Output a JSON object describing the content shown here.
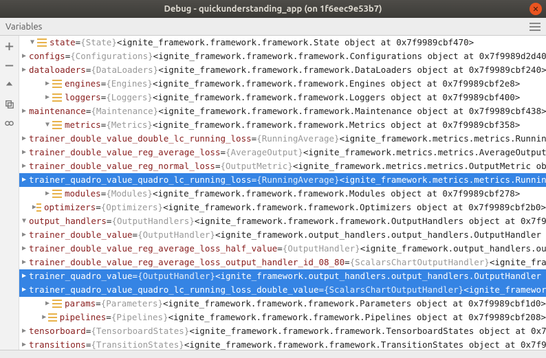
{
  "window": {
    "title": "Debug - quickunderstanding_app (on 1f6eec9e53b7)",
    "tab": "Variables"
  },
  "tree": [
    {
      "depth": 0,
      "arrow": "down",
      "name": "state",
      "eq": " = ",
      "type": "{State}",
      "desc": " <ignite_framework.framework.framework.State object at 0x7f9989cbf470>",
      "sel": false
    },
    {
      "depth": 1,
      "arrow": "right",
      "name": "configs",
      "eq": " = ",
      "type": "{Configurations}",
      "desc": " <ignite_framework.framework.framework.Configurations object at 0x7f9989d2d400>",
      "sel": false
    },
    {
      "depth": 1,
      "arrow": "right",
      "name": "dataloaders",
      "eq": " = ",
      "type": "{DataLoaders}",
      "desc": " <ignite_framework.framework.framework.DataLoaders object at 0x7f9989cbf240>",
      "sel": false
    },
    {
      "depth": 1,
      "arrow": "right",
      "name": "engines",
      "eq": " = ",
      "type": "{Engines}",
      "desc": " <ignite_framework.framework.framework.Engines object at 0x7f9989cbf2e8>",
      "sel": false
    },
    {
      "depth": 1,
      "arrow": "right",
      "name": "loggers",
      "eq": " = ",
      "type": "{Loggers}",
      "desc": " <ignite_framework.framework.framework.Loggers object at 0x7f9989cbf400>",
      "sel": false
    },
    {
      "depth": 1,
      "arrow": "right",
      "name": "maintenance",
      "eq": " = ",
      "type": "{Maintenance}",
      "desc": " <ignite_framework.framework.framework.Maintenance object at 0x7f9989cbf438>",
      "sel": false
    },
    {
      "depth": 1,
      "arrow": "down",
      "name": "metrics",
      "eq": " = ",
      "type": "{Metrics}",
      "desc": " <ignite_framework.framework.framework.Metrics object at 0x7f9989cbf358>",
      "sel": false
    },
    {
      "depth": 2,
      "arrow": "right",
      "name": "trainer_double_value_double_lc_running_loss",
      "eq": " = ",
      "type": "{RunningAverage}",
      "desc": " <ignite_framework.metrics.metrics.RunningA…",
      "sel": false
    },
    {
      "depth": 2,
      "arrow": "right",
      "name": "trainer_double_value_reg_average_loss",
      "eq": " = ",
      "type": "{AverageOutput}",
      "desc": " <ignite_framework.metrics.metrics.AverageOutput ob",
      "sel": false
    },
    {
      "depth": 2,
      "arrow": "right",
      "name": "trainer_double_value_reg_normal_loss",
      "eq": " = ",
      "type": "{OutputMetric}",
      "desc": " <ignite_framework.metrics.metrics.OutputMetric object a",
      "sel": false
    },
    {
      "depth": 2,
      "arrow": "right",
      "name": "trainer_quadro_value_quadro_lc_running_loss",
      "eq": " = ",
      "type": "{RunningAverage}",
      "desc": " <ignite_framework.metrics.metrics.RunningA",
      "sel": true
    },
    {
      "depth": 1,
      "arrow": "right",
      "name": "modules",
      "eq": " = ",
      "type": "{Modules}",
      "desc": " <ignite_framework.framework.framework.Modules object at 0x7f9989cbf278>",
      "sel": false
    },
    {
      "depth": 1,
      "arrow": "right",
      "name": "optimizers",
      "eq": " = ",
      "type": "{Optimizers}",
      "desc": " <ignite_framework.framework.framework.Optimizers object at 0x7f9989cbf2b0>",
      "sel": false
    },
    {
      "depth": 1,
      "arrow": "down",
      "name": "output_handlers",
      "eq": " = ",
      "type": "{OutputHandlers}",
      "desc": " <ignite_framework.framework.framework.OutputHandlers object at 0x7f9989c",
      "sel": false
    },
    {
      "depth": 2,
      "arrow": "right",
      "name": "trainer_double_value",
      "eq": " = ",
      "type": "{OutputHandler}",
      "desc": " <ignite_framework.output_handlers.output_handlers.OutputHandler obj",
      "sel": false
    },
    {
      "depth": 2,
      "arrow": "right",
      "name": "trainer_double_value_reg_average_loss_half_value",
      "eq": " = ",
      "type": "{OutputHandler}",
      "desc": " <ignite_framework.output_handlers.output",
      "sel": false
    },
    {
      "depth": 2,
      "arrow": "right",
      "name": "trainer_double_value_reg_average_loss_output_handler_id_08_80",
      "eq": " = ",
      "type": "{ScalarsChartOutputHandler}",
      "desc": " <ignite_framew",
      "sel": false
    },
    {
      "depth": 2,
      "arrow": "right",
      "name": "trainer_quadro_value",
      "eq": " = ",
      "type": "{OutputHandler}",
      "desc": " <ignite_framework.output_handlers.output_handlers.OutputHandler ob",
      "sel": true
    },
    {
      "depth": 2,
      "arrow": "right",
      "name": "trainer_quadro_value_quadro_lc_running_loss_double_value",
      "eq": " = ",
      "type": "{ScalarsChartOutputHandler}",
      "desc": " <ignite_framework.o",
      "sel": true
    },
    {
      "depth": 1,
      "arrow": "right",
      "name": "params",
      "eq": " = ",
      "type": "{Parameters}",
      "desc": " <ignite_framework.framework.framework.Parameters object at 0x7f9989cbf1d0>",
      "sel": false
    },
    {
      "depth": 1,
      "arrow": "right",
      "name": "pipelines",
      "eq": " = ",
      "type": "{Pipelines}",
      "desc": " <ignite_framework.framework.framework.Pipelines object at 0x7f9989cbf208>",
      "sel": false
    },
    {
      "depth": 1,
      "arrow": "right",
      "name": "tensorboard",
      "eq": " = ",
      "type": "{TensorboardStates}",
      "desc": " <ignite_framework.framework.framework.TensorboardStates object at 0x7f9989",
      "sel": false
    },
    {
      "depth": 1,
      "arrow": "right",
      "name": "transitions",
      "eq": " = ",
      "type": "{TransitionStates}",
      "desc": " <ignite_framework.framework.framework.TransitionStates object at 0x7f9989cbf390",
      "sel": false
    }
  ]
}
